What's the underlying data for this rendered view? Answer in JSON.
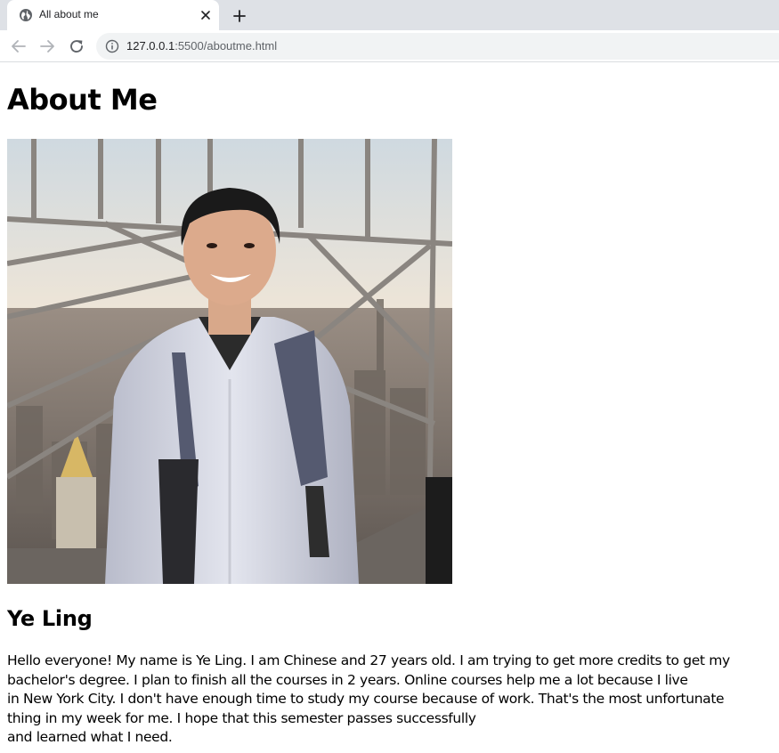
{
  "browser": {
    "tab_title": "All about me",
    "url_host": "127.0.0.1",
    "url_path": ":5500/aboutme.html",
    "icons": {
      "favicon": "globe-icon",
      "close": "close-icon",
      "new_tab": "plus-icon",
      "back": "back-arrow-icon",
      "forward": "forward-arrow-icon",
      "reload": "reload-icon",
      "info": "info-icon"
    }
  },
  "page": {
    "title": "About Me",
    "photo": "profile-photo",
    "name": "Ye Ling",
    "bio_lines": [
      "Hello everyone! My name is Ye Ling. I am Chinese and 27 years old. I am trying to get more credits to get my",
      "bachelor's degree. I plan to finish all the courses in 2 years. Online courses help me a lot because I live",
      "in New York City. I don't have enough time to study my course because of work. That's the most unfortunate",
      "thing in my week for me. I hope that this semester passes successfully",
      "and learned what I need."
    ]
  },
  "colors": {
    "tabstrip": "#dee1e6",
    "omnibox": "#f1f3f4",
    "page_background": "#ffffff",
    "text": "#000000"
  }
}
